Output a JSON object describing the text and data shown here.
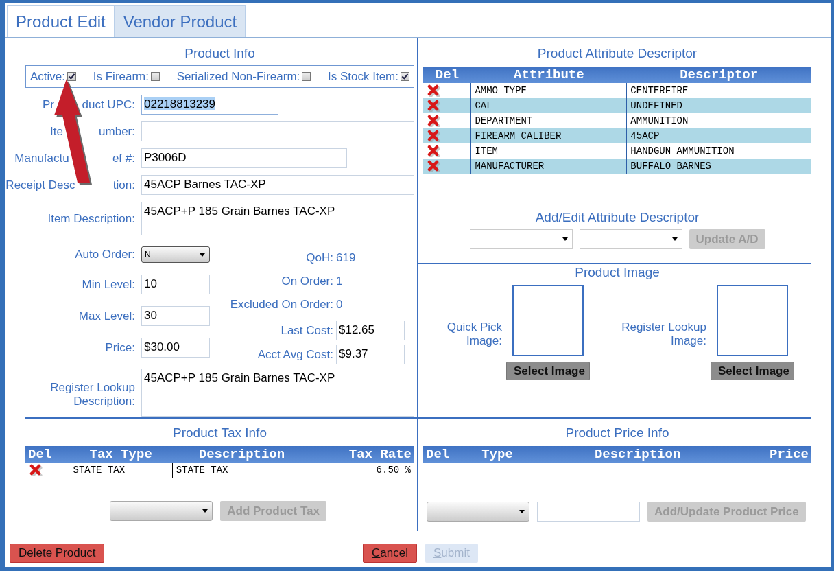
{
  "tabs": [
    {
      "label": "Product Edit",
      "selected": true
    },
    {
      "label": "Vendor Product",
      "selected": false
    }
  ],
  "product_info": {
    "title": "Product Info",
    "flags": [
      {
        "label": "Active:",
        "checked": true
      },
      {
        "label": "Is Firearm:",
        "checked": false
      },
      {
        "label": "Serialized Non-Firearm:",
        "checked": false
      },
      {
        "label": "Is Stock Item:",
        "checked": true
      }
    ],
    "fields": [
      {
        "label_parts": [
          "Pr",
          "duct UPC:"
        ],
        "value": "02218813239",
        "kind": "short",
        "text_selected": true
      },
      {
        "label_parts": [
          "Ite",
          "umber:"
        ],
        "kind": "wide",
        "text_selected": false
      },
      {
        "label_parts": [
          "Manufactu",
          "ef #:"
        ],
        "value": "P3006D",
        "kind": "medium",
        "text_selected": false
      },
      {
        "label_parts": [
          "Receipt Desc",
          "tion:"
        ],
        "value": "45ACP Barnes TAC-XP",
        "kind": "wide",
        "text_selected": false
      },
      {
        "label": "Item Description:",
        "value": "45ACP+P 185 Grain Barnes TAC-XP",
        "kind": "area",
        "text_selected": false
      }
    ],
    "auto_order": {
      "label": "Auto Order:",
      "value": "N"
    },
    "levels": [
      {
        "label": "Min Level:",
        "value": "10"
      },
      {
        "label": "Max Level:",
        "value": "30"
      },
      {
        "label": "Price:",
        "value": "$30.00"
      }
    ],
    "stock": [
      {
        "label": "QoH:",
        "value": "619",
        "kind": "text"
      },
      {
        "label": "On Order:",
        "value": "1",
        "kind": "text"
      },
      {
        "label": "Excluded On Order:",
        "value": "0",
        "kind": "text"
      },
      {
        "label": "Last Cost:",
        "value": "$12.65",
        "kind": "field"
      },
      {
        "label": "Acct Avg Cost:",
        "value": "$9.37",
        "kind": "field"
      }
    ],
    "register_lookup": {
      "label": "Register Lookup Description:",
      "value": "45ACP+P 185 Grain Barnes TAC-XP"
    }
  },
  "attributes": {
    "title": "Product Attribute Descriptor",
    "columns": [
      "Del",
      "Attribute",
      "Descriptor"
    ],
    "rows": [
      {
        "attribute": "AMMO TYPE",
        "descriptor": "CENTERFIRE"
      },
      {
        "attribute": "CAL",
        "descriptor": "UNDEFINED"
      },
      {
        "attribute": "DEPARTMENT",
        "descriptor": "AMMUNITION"
      },
      {
        "attribute": "FIREARM CALIBER",
        "descriptor": "45ACP"
      },
      {
        "attribute": "ITEM",
        "descriptor": "HANDGUN AMMUNITION"
      },
      {
        "attribute": "MANUFACTURER",
        "descriptor": "BUFFALO BARNES"
      }
    ],
    "edit_title": "Add/Edit Attribute Descriptor",
    "button": {
      "label": "Update A/D",
      "disabled": true
    }
  },
  "image": {
    "title": "Product Image",
    "slots": [
      {
        "label": "Quick Pick Image:",
        "button": "Select Image"
      },
      {
        "label": "Register Lookup Image:",
        "button": "Select Image"
      }
    ]
  },
  "tax": {
    "title": "Product Tax Info",
    "columns": [
      "Del",
      "Tax Type",
      "Description",
      "Tax Rate"
    ],
    "rows": [
      {
        "tax_type": "STATE TAX",
        "description": "STATE TAX",
        "tax_rate": "6.50 %"
      }
    ],
    "button": {
      "label": "Add Product Tax",
      "disabled": true
    }
  },
  "price": {
    "title": "Product Price Info",
    "columns": [
      "Del",
      "Type",
      "Description",
      "Price"
    ],
    "button": {
      "label": "Add/Update Product Price",
      "disabled": true
    }
  },
  "footer": [
    {
      "label": "Delete Product",
      "kind": "danger",
      "disabled": false,
      "accel": false
    },
    {
      "label": "Cancel",
      "kind": "danger",
      "disabled": false,
      "accel": true
    },
    {
      "label": "Submit",
      "kind": "primary",
      "disabled": true,
      "accel": true
    }
  ]
}
